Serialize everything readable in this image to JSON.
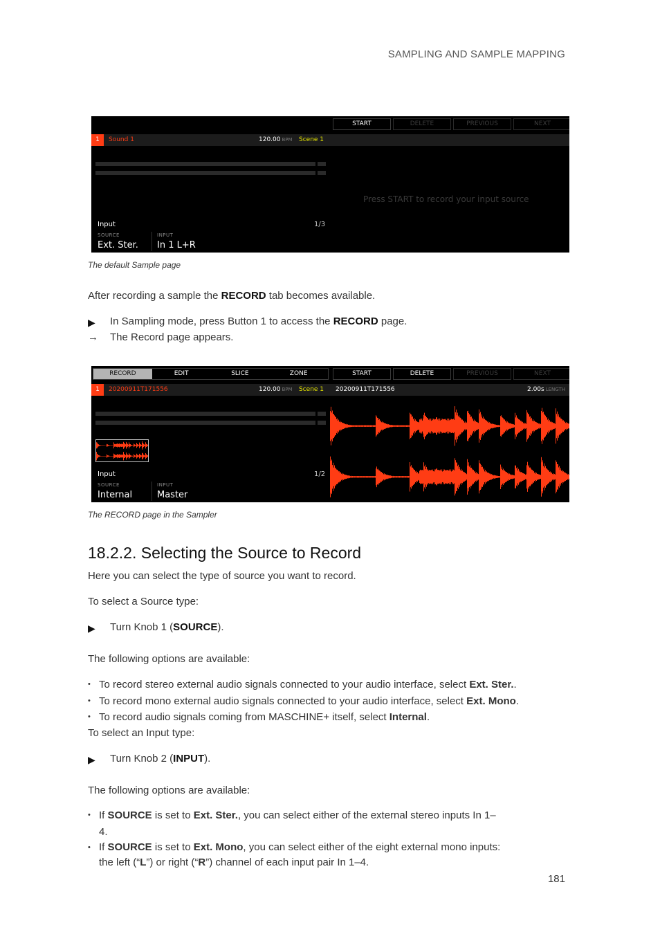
{
  "header": {
    "section": "SAMPLING AND SAMPLE MAPPING"
  },
  "page_number": "181",
  "screen1": {
    "buttons": [
      {
        "label": "START",
        "state": "active"
      },
      {
        "label": "DELETE",
        "state": "disabled"
      },
      {
        "label": "PREVIOUS",
        "state": "disabled"
      },
      {
        "label": "NEXT",
        "state": "disabled"
      }
    ],
    "slot": "1",
    "sound_name": "Sound 1",
    "bpm_value": "120.00",
    "bpm_unit": "BPM",
    "scene": "Scene 1",
    "hint": "Press START to record your input source",
    "input_label": "Input",
    "page_indicator": "1/3",
    "source_label": "SOURCE",
    "source_value": "Ext. Ster.",
    "input_knob_label": "INPUT",
    "input_value": "In 1 L+R"
  },
  "caption1": "The default Sample page",
  "para1": {
    "pre": "After recording a sample the ",
    "bold": "RECORD",
    "post": " tab becomes available."
  },
  "step1": {
    "marker": "▶",
    "pre": "In Sampling mode, press Button 1 to access the ",
    "bold": "RECORD",
    "post": " page."
  },
  "result1": {
    "marker": "→",
    "text": "The Record page appears."
  },
  "screen2": {
    "tabs": [
      {
        "label": "RECORD",
        "selected": true
      },
      {
        "label": "EDIT",
        "selected": false
      },
      {
        "label": "SLICE",
        "selected": false
      },
      {
        "label": "ZONE",
        "selected": false
      }
    ],
    "buttons": [
      {
        "label": "START",
        "state": "active"
      },
      {
        "label": "DELETE",
        "state": "active"
      },
      {
        "label": "PREVIOUS",
        "state": "disabled"
      },
      {
        "label": "NEXT",
        "state": "disabled"
      }
    ],
    "slot": "1",
    "sound_name": "20200911T171556",
    "bpm_value": "120.00",
    "bpm_unit": "BPM",
    "scene": "Scene 1",
    "sample_name": "20200911T171556",
    "length_value": "2.00s",
    "length_unit": "LENGTH",
    "input_label": "Input",
    "page_indicator": "1/2",
    "source_label": "SOURCE",
    "source_value": "Internal",
    "input_knob_label": "INPUT",
    "input_value": "Master",
    "waveform_color": "#ff3c14"
  },
  "caption2": "The RECORD page in the Sampler",
  "section_title": "18.2.2. Selecting the Source to Record",
  "intro": "Here you can select the type of source you want to record.",
  "source_select": "To select a Source type:",
  "step2": {
    "marker": "▶",
    "pre": "Turn Knob 1 (",
    "bold": "SOURCE",
    "post": ")."
  },
  "options_intro1": "The following options are available:",
  "source_options": [
    {
      "pre": "To record stereo external audio signals connected to your audio interface, select ",
      "bold": "Ext. Ster.",
      "post": "."
    },
    {
      "pre": "To record mono external audio signals connected to your audio interface, select ",
      "bold": "Ext. Mono",
      "post": "."
    },
    {
      "pre": "To record audio signals coming from MASCHINE+ itself, select ",
      "bold": "Internal",
      "post": "."
    }
  ],
  "input_select": "To select an Input type:",
  "step3": {
    "marker": "▶",
    "pre": "Turn Knob 2 (",
    "bold": "INPUT",
    "post": ")."
  },
  "options_intro2": "The following options are available:",
  "input_options": [
    {
      "t1": "If ",
      "b1": "SOURCE",
      "t2": " is set to ",
      "b2": "Ext. Ster.",
      "t3": ", you can select either of the external stereo inputs In 1–4."
    },
    {
      "t1": "If ",
      "b1": "SOURCE",
      "t2": " is set to ",
      "b2": "Ext. Mono",
      "t3": ", you can select either of the eight external mono inputs: the left (“",
      "b3": "L",
      "t4": "”) or right (“",
      "b4": "R",
      "t5": "”) channel of each input pair In 1–4."
    }
  ]
}
